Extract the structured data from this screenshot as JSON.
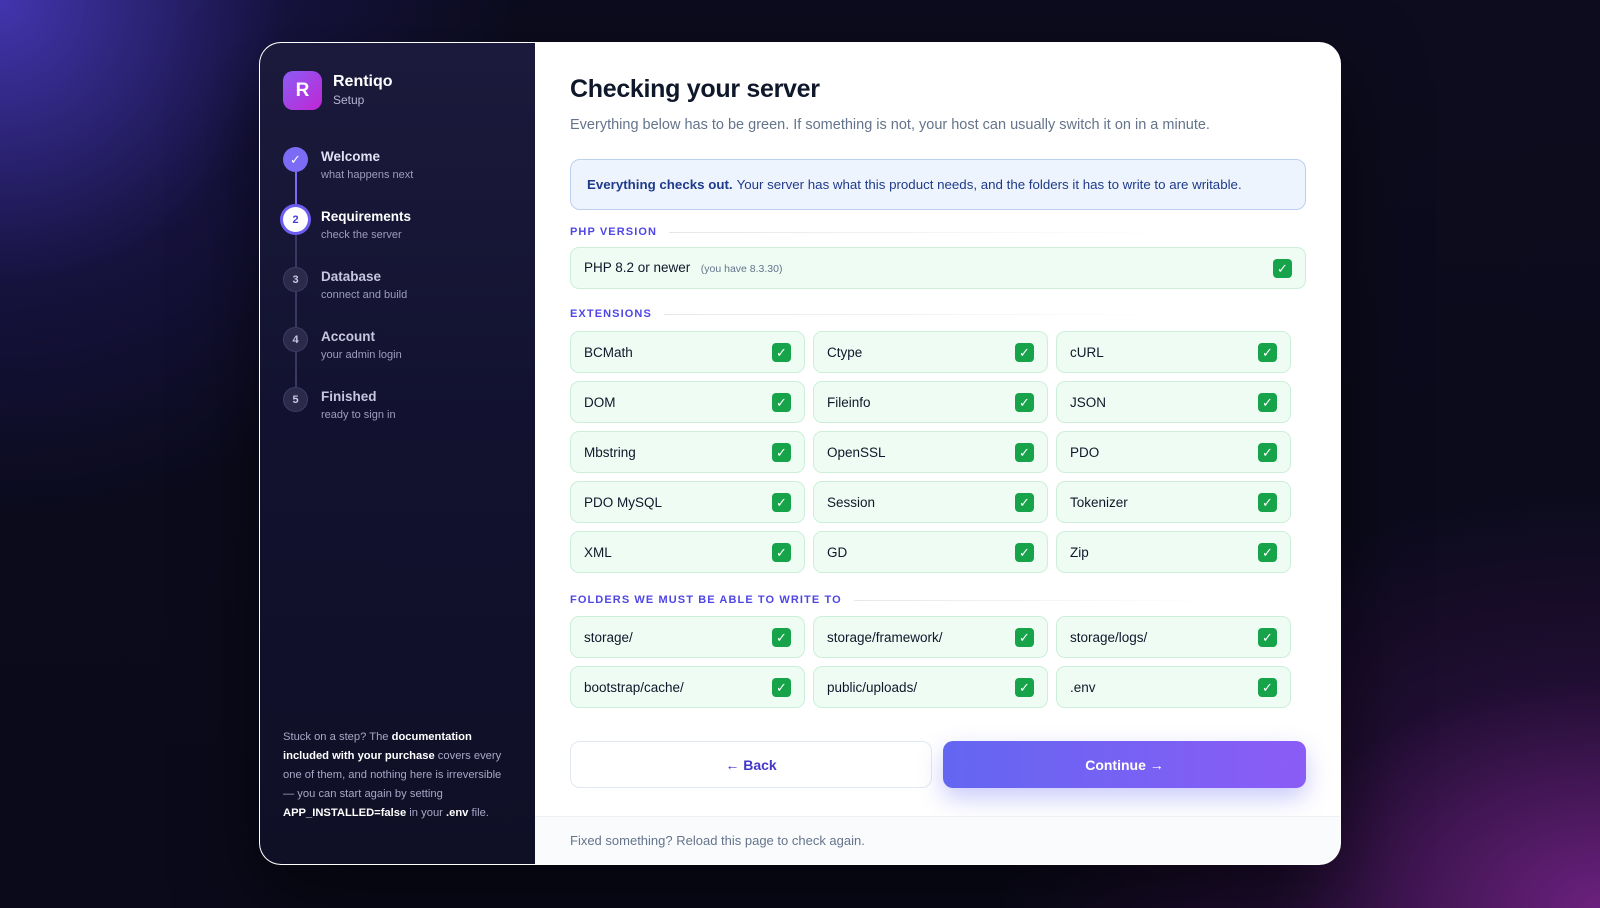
{
  "brand": {
    "logo_letter": "R",
    "name": "Rentiqo",
    "sub": "Setup"
  },
  "steps": [
    {
      "marker": "✓",
      "title": "Welcome",
      "sub": "what happens next",
      "state": "done"
    },
    {
      "marker": "2",
      "title": "Requirements",
      "sub": "check the server",
      "state": "current"
    },
    {
      "marker": "3",
      "title": "Database",
      "sub": "connect and build",
      "state": "todo"
    },
    {
      "marker": "4",
      "title": "Account",
      "sub": "your admin login",
      "state": "todo"
    },
    {
      "marker": "5",
      "title": "Finished",
      "sub": "ready to sign in",
      "state": "todo"
    }
  ],
  "help": {
    "t1": "Stuck on a step? The ",
    "b1": "documentation included with your purchase",
    "t2": " covers every one of them, and nothing here is irreversible — you can start again by setting ",
    "b2": "APP_INSTALLED=false",
    "t3": " in your ",
    "b3": ".env",
    "t4": " file."
  },
  "main": {
    "title": "Checking your server",
    "subtitle": "Everything below has to be green. If something is not, your host can usually switch it on in a minute.",
    "notice_bold": "Everything checks out.",
    "notice_text": "Your server has what this product needs, and the folders it has to write to are writable."
  },
  "sections": {
    "php": "PHP VERSION",
    "extensions": "EXTENSIONS",
    "folders": "FOLDERS WE MUST BE ABLE TO WRITE TO"
  },
  "php": {
    "label": "PHP 8.2 or newer",
    "hint": "(you have 8.3.30)",
    "status": "✓"
  },
  "extensions": [
    {
      "label": "BCMath",
      "status": "✓"
    },
    {
      "label": "Ctype",
      "status": "✓"
    },
    {
      "label": "cURL",
      "status": "✓"
    },
    {
      "label": "DOM",
      "status": "✓"
    },
    {
      "label": "Fileinfo",
      "status": "✓"
    },
    {
      "label": "JSON",
      "status": "✓"
    },
    {
      "label": "Mbstring",
      "status": "✓"
    },
    {
      "label": "OpenSSL",
      "status": "✓"
    },
    {
      "label": "PDO",
      "status": "✓"
    },
    {
      "label": "PDO MySQL",
      "status": "✓"
    },
    {
      "label": "Session",
      "status": "✓"
    },
    {
      "label": "Tokenizer",
      "status": "✓"
    },
    {
      "label": "XML",
      "status": "✓"
    },
    {
      "label": "GD",
      "status": "✓"
    },
    {
      "label": "Zip",
      "status": "✓"
    }
  ],
  "folders": [
    {
      "label": "storage/",
      "status": "✓"
    },
    {
      "label": "storage/framework/",
      "status": "✓"
    },
    {
      "label": "storage/logs/",
      "status": "✓"
    },
    {
      "label": "bootstrap/cache/",
      "status": "✓"
    },
    {
      "label": "public/uploads/",
      "status": "✓"
    },
    {
      "label": ".env",
      "status": "✓"
    }
  ],
  "buttons": {
    "back": "← Back",
    "continue": "Continue →"
  },
  "footer": "Fixed something? Reload this page to check again.",
  "colors": {
    "accent": "#6366f1",
    "success": "#16a34a",
    "success_bg": "#effcf4"
  }
}
